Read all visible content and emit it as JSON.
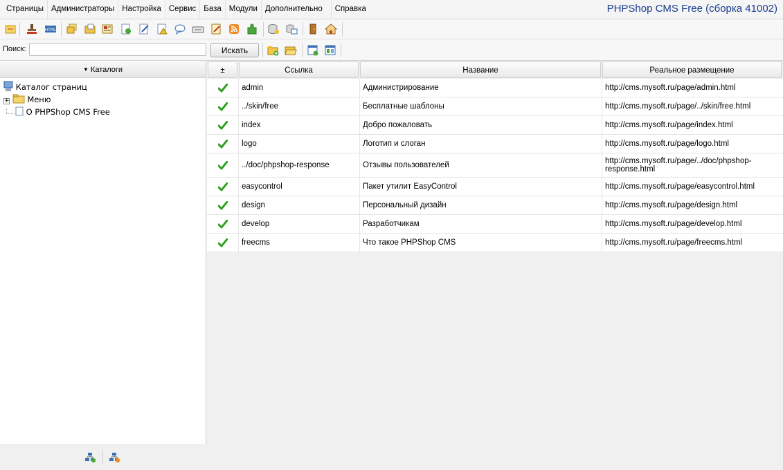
{
  "menubar": {
    "items": [
      "Страницы",
      "Администраторы",
      "Настройка",
      "Сервис",
      "База",
      "Модули",
      "Дополнительно",
      "Справка"
    ],
    "title": "PHPShop CMS Free (сборка 41002)"
  },
  "search": {
    "label": "Поиск:",
    "value": "",
    "placeholder": "",
    "button_label": "Искать"
  },
  "left_panel": {
    "header": "Каталоги",
    "tree": [
      {
        "label": "Каталог страниц"
      },
      {
        "label": "Меню"
      },
      {
        "label": "О PHPShop CMS Free"
      }
    ]
  },
  "grid": {
    "columns": [
      "±",
      "Ссылка",
      "Название",
      "Реальное размещение"
    ],
    "rows": [
      {
        "link": "admin",
        "name": "Администрирование",
        "url": "http://cms.mysoft.ru/page/admin.html"
      },
      {
        "link": "../skin/free",
        "name": "Бесплатные шаблоны",
        "url": "http://cms.mysoft.ru/page/../skin/free.html"
      },
      {
        "link": "index",
        "name": "Добро пожаловать",
        "url": "http://cms.mysoft.ru/page/index.html"
      },
      {
        "link": "logo",
        "name": "Логотип и слоган",
        "url": "http://cms.mysoft.ru/page/logo.html"
      },
      {
        "link": "../doc/phpshop-response",
        "name": "Отзывы пользователей",
        "url": "http://cms.mysoft.ru/page/../doc/phpshop-response.html"
      },
      {
        "link": "easycontrol",
        "name": "Пакет утилит EasyControl",
        "url": "http://cms.mysoft.ru/page/easycontrol.html"
      },
      {
        "link": "design",
        "name": "Персональный дизайн",
        "url": "http://cms.mysoft.ru/page/design.html"
      },
      {
        "link": "develop",
        "name": "Разработчикам",
        "url": "http://cms.mysoft.ru/page/develop.html"
      },
      {
        "link": "freecms",
        "name": "Что такое PHPShop CMS",
        "url": "http://cms.mysoft.ru/page/freecms.html"
      }
    ]
  },
  "colors": {
    "title": "#1a3c8e",
    "check": "#2e9e1f"
  }
}
